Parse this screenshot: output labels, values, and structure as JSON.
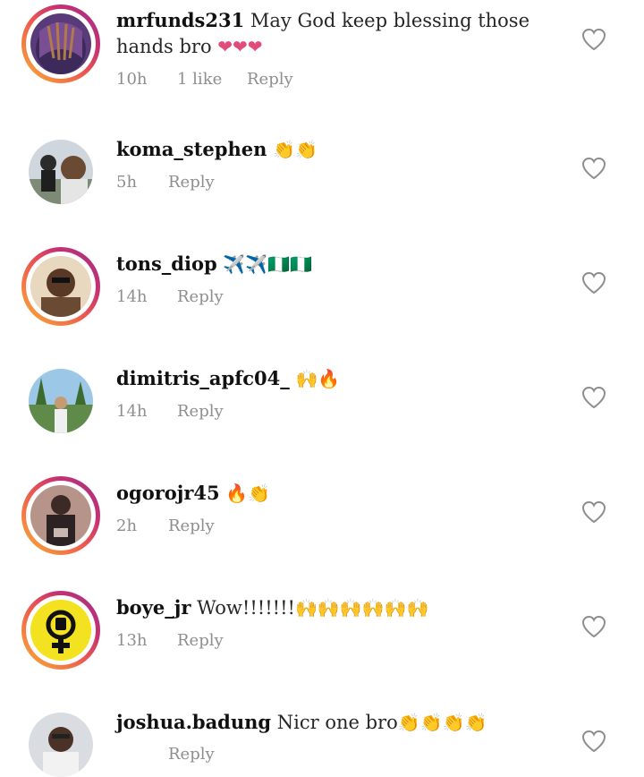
{
  "comments": [
    {
      "username": "mrfunds231",
      "text": "May God keep blessing those hands bro",
      "emoji": "❤❤❤",
      "time": "10h",
      "likes": "1 like",
      "reply": "Reply"
    },
    {
      "username": "koma_stephen",
      "text": "",
      "emoji": "👏👏",
      "time": "5h",
      "reply": "Reply"
    },
    {
      "username": "tons_diop",
      "text": "",
      "emoji": "✈️✈️🇳🇬🇳🇬",
      "time": "14h",
      "reply": "Reply"
    },
    {
      "username": "dimitris_apfc04_",
      "text": "",
      "emoji": "🙌🔥",
      "time": "14h",
      "reply": "Reply"
    },
    {
      "username": "ogorojr45",
      "text": "",
      "emoji": "🔥👏",
      "time": "2h",
      "reply": "Reply"
    },
    {
      "username": "boye_jr",
      "text": "Wow!!!!!!!",
      "emoji": "🙌🙌🙌🙌🙌🙌",
      "time": "13h",
      "reply": "Reply"
    },
    {
      "username": "joshua.badung",
      "text": "Nicr one bro",
      "emoji": "👏👏👏👏",
      "time": "",
      "reply": "Reply"
    }
  ],
  "colors": {
    "meta": "#8e8e8e",
    "story_ring": "#ee5a4f"
  },
  "icons": {
    "like": "heart-outline-icon"
  }
}
